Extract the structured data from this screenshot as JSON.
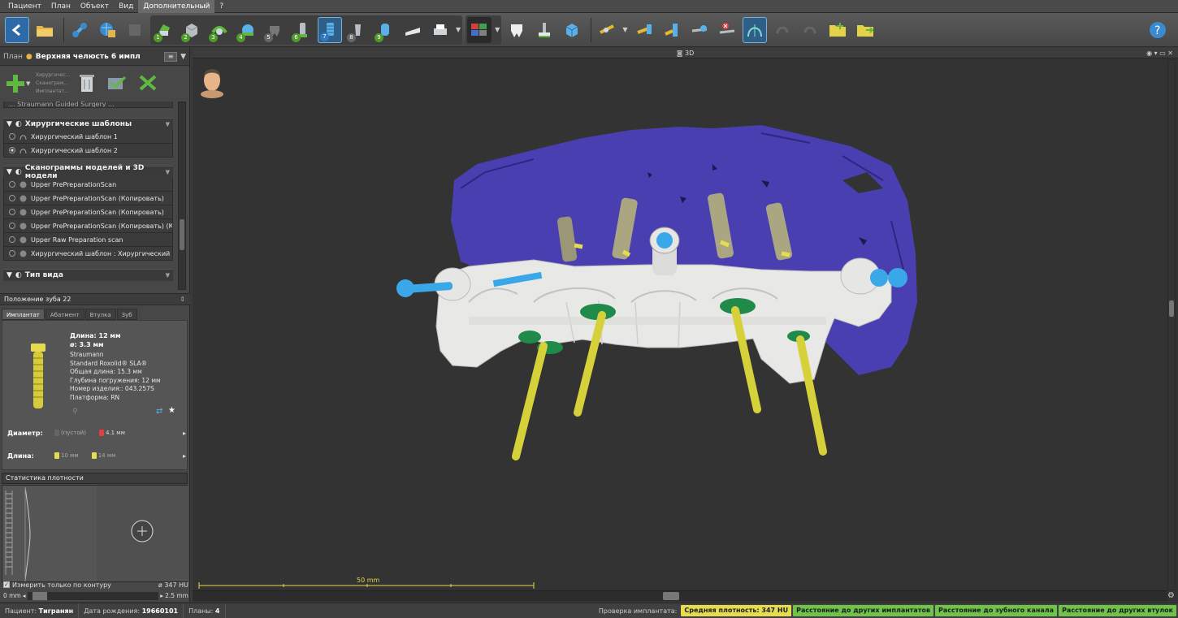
{
  "menu": [
    "Пациент",
    "План",
    "Объект",
    "Вид",
    "Дополнительный",
    "?"
  ],
  "menu_active_index": 4,
  "toolbar": {
    "step_numbers": [
      "1",
      "2",
      "3",
      "4",
      "5",
      "6",
      "7",
      "8",
      "9"
    ],
    "selected_step": "7"
  },
  "plan": {
    "label": "План",
    "name": "Верхняя челюсть 6 импл",
    "mini_lines": [
      "Хирургичес...",
      "Сканограм...",
      "Имплантат..."
    ]
  },
  "tree": {
    "cut_row": "... Straumann Guided Surgery ...",
    "sections": [
      {
        "title": "Хирургические шаблоны",
        "rows": [
          {
            "label": "Хирургический шаблон 1",
            "selected": false
          },
          {
            "label": "Хирургический шаблон 2",
            "selected": true
          }
        ]
      },
      {
        "title": "Сканограммы моделей и 3D модели",
        "rows": [
          {
            "label": "Upper PrePreparationScan",
            "selected": false
          },
          {
            "label": "Upper PrePreparationScan (Копировать)",
            "selected": false
          },
          {
            "label": "Upper PrePreparationScan (Копировать)",
            "selected": false
          },
          {
            "label": "Upper PrePreparationScan (Копировать) (К...",
            "selected": false
          },
          {
            "label": "Upper Raw Preparation scan",
            "selected": false
          },
          {
            "label": "Хирургический шаблон : Хирургический ...",
            "selected": false
          }
        ]
      },
      {
        "title": "Тип вида",
        "rows": []
      }
    ]
  },
  "tooth_position": "Положение зуба 22",
  "implant_tabs": [
    "Имплантат",
    "Абатмент",
    "Втулка",
    "Зуб"
  ],
  "implant": {
    "length": "Длина: 12 мм",
    "diameter": "ø: 3.3 мм",
    "brand": "Straumann",
    "line": "Standard Roxolid® SLA®",
    "total_length": "Общая длина: 15.3 мм",
    "depth": "Глубина погружения: 12 мм",
    "article": "Номер изделия:: 043.257S",
    "platform": "Платформа: RN"
  },
  "params": {
    "diameter_label": "Диаметр:",
    "diameter_prev": "(пустой)",
    "diameter_next": "4.1 мм",
    "length_label": "Длина:",
    "length_prev": "10 мм",
    "length_next": "14 мм"
  },
  "density": {
    "title": "Статистика плотности",
    "contour_label": "Измерить только по контуру",
    "hu_value": "ø 347 HU",
    "range_min": "0 mm",
    "range_max": "2.5 mm"
  },
  "viewport": {
    "title": "3D",
    "scale_label": "50 mm"
  },
  "status": {
    "patient_label": "Пациент:",
    "patient": "Тигранян",
    "dob_label": "Дата рождения:",
    "dob": "19660101",
    "plans_label": "Планы:",
    "plans": "4",
    "check_label": "Проверка имплантата:",
    "badges": [
      {
        "text": "Средняя плотность: 347 HU",
        "color": "#e6dc50"
      },
      {
        "text": "Расстояние до других имплантатов",
        "color": "#6fc24a"
      },
      {
        "text": "Расстояние до зубного канала",
        "color": "#6fc24a"
      },
      {
        "text": "Расстояние до других втулок",
        "color": "#6fc24a"
      }
    ]
  },
  "colors": {
    "accent": "#2f5f86",
    "scan_blue": "#4a3fb0",
    "guide_white": "#e8e8e6",
    "pin_yellow": "#d6d13a",
    "sleeve_green": "#1f8a4a",
    "anchor_blue": "#3aa8e8"
  }
}
